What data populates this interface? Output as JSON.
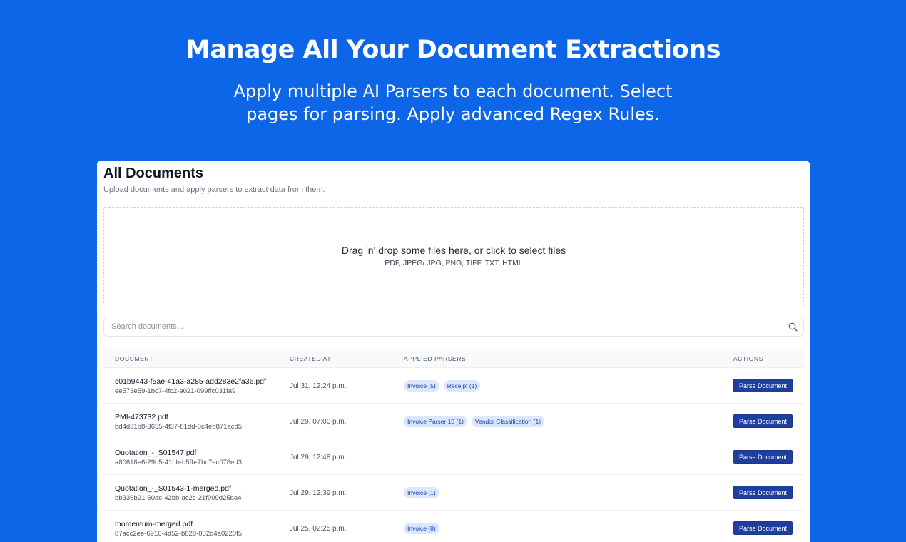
{
  "hero": {
    "title": "Manage All Your Document Extractions",
    "subtitle_line1": "Apply multiple AI Parsers to each document. Select",
    "subtitle_line2": "pages for parsing. Apply advanced Regex Rules."
  },
  "page": {
    "title": "All Documents",
    "description": "Upload documents and apply parsers to extract data from them."
  },
  "dropzone": {
    "text": "Drag 'n' drop some files here, or click to select files",
    "types": "PDF, JPEG/ JPG, PNG, TIFF, TXT, HTML"
  },
  "search": {
    "placeholder": "Search documents...",
    "icon": "search-icon"
  },
  "table": {
    "headers": {
      "document": "DOCUMENT",
      "created_at": "CREATED AT",
      "applied_parsers": "APPLIED PARSERS",
      "actions": "ACTIONS"
    },
    "rows": [
      {
        "name": "c01b9443-f5ae-41a3-a285-add283e2fa36.pdf",
        "id": "ee573e59-1bc7-4fc2-a021-099ffc031fa9",
        "created": "Jul 31, 12:24 p.m.",
        "parsers": [
          "Invoice (5)",
          "Receipt (1)"
        ],
        "action": "Parse Document"
      },
      {
        "name": "PMI-473732.pdf",
        "id": "bd4d31b8-3655-4f37-81dd-0c4eb871acd5",
        "created": "Jul 29, 07:00 p.m.",
        "parsers": [
          "Invoice Parser 10 (1)",
          "Vendor Classification (1)"
        ],
        "action": "Parse Document"
      },
      {
        "name": "Quotation_-_S01547.pdf",
        "id": "a80618e6-29b5-41bb-b5fb-7bc7ec078ed3",
        "created": "Jul 29, 12:48 p.m.",
        "parsers": [],
        "action": "Parse Document"
      },
      {
        "name": "Quotation_-_S01543-1-merged.pdf",
        "id": "bb336b21-60ac-42bb-ac2c-21f909d25ba4",
        "created": "Jul 29, 12:39 p.m.",
        "parsers": [
          "Invoice (1)"
        ],
        "action": "Parse Document"
      },
      {
        "name": "momentum-merged.pdf",
        "id": "87acc2ee-6910-4d52-b828-052d4a0220f5",
        "created": "Jul 25, 02:25 p.m.",
        "parsers": [
          "Invoice (8)"
        ],
        "action": "Parse Document"
      }
    ]
  },
  "colors": {
    "background": "#0d66e8",
    "button": "#1e3f9e",
    "chip_bg": "#dbe8fb",
    "chip_text": "#1e40af"
  }
}
